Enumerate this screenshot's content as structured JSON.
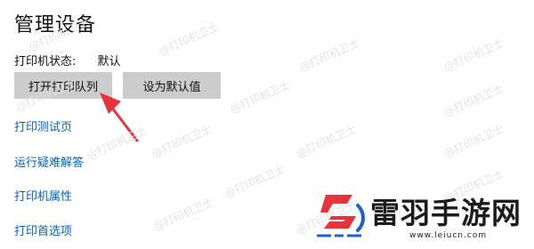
{
  "page": {
    "title": "管理设备",
    "status_label": "打印机状态:",
    "status_value": "默认"
  },
  "buttons": {
    "open_queue": "打开打印队列",
    "set_default": "设为默认值"
  },
  "links": [
    "打印测试页",
    "运行疑难解答",
    "打印机属性",
    "打印首选项"
  ],
  "watermark": "@打印机卫士",
  "logo": {
    "brand": "雷羽手游网",
    "url": "www.leiucn.com"
  },
  "colors": {
    "link": "#0064c8",
    "button_bg": "#cccccc",
    "arrow": "#e8333c",
    "logo_red": "#e8333c",
    "logo_blue": "#1d5fd8"
  },
  "icons": [
    "arrow-pointer-icon",
    "logo-mark-icon"
  ]
}
